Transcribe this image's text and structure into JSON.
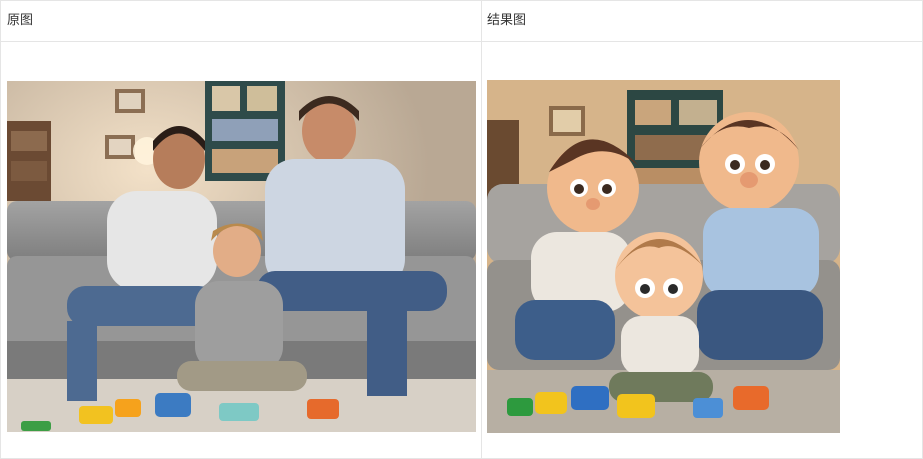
{
  "headers": {
    "original_label": "原图",
    "result_label": "结果图"
  },
  "images": {
    "original": {
      "description_name": "family-photo",
      "palette": {
        "wall": "#c9b8a6",
        "sofa": "#9c9c9c",
        "carpet": "#d7d0c6"
      }
    },
    "result": {
      "description_name": "cartoon-family",
      "palette": {
        "wall": "#d9b78c",
        "sofa": "#a8a5a0",
        "carpet": "#b9b1a6"
      }
    }
  }
}
